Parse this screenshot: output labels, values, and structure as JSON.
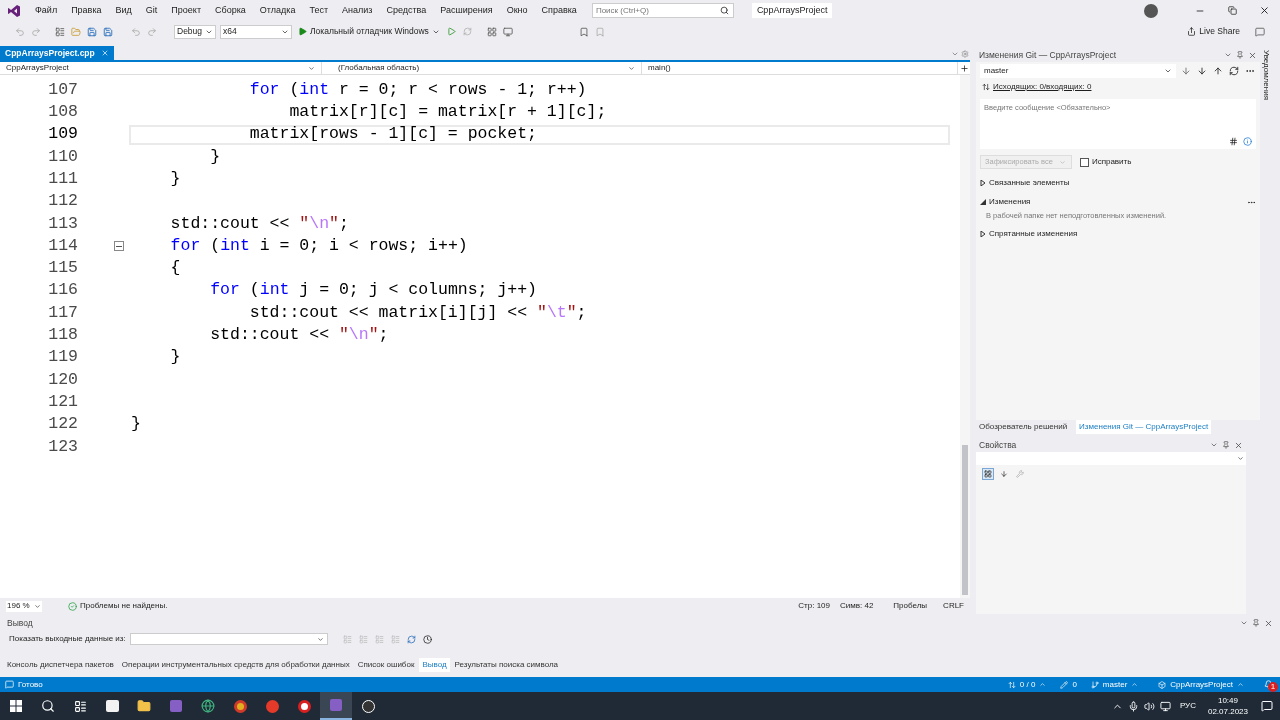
{
  "menu": [
    "Файл",
    "Правка",
    "Вид",
    "Git",
    "Проект",
    "Сборка",
    "Отладка",
    "Тест",
    "Анализ",
    "Средства",
    "Расширения",
    "Окно",
    "Справка"
  ],
  "search": {
    "placeholder": "Поиск (Ctrl+Q)"
  },
  "solution_name": "CppArraysProject",
  "toolbar": {
    "configuration": "Debug",
    "platform": "x64",
    "run": "Локальный отладчик Windows",
    "live_share": "Live Share"
  },
  "editor": {
    "tabs": [
      {
        "label": "CppArraysProject.cpp",
        "selected": true
      }
    ],
    "nav": [
      "CppArraysProject",
      "(Глобальная область)",
      "main()"
    ],
    "lines": [
      {
        "number": "107",
        "current": false,
        "kind": "code",
        "tokens": [
          {
            "text": "            for",
            "kind": "keyword"
          },
          {
            "text": " (",
            "kind": "plain"
          },
          {
            "text": "int",
            "kind": "keyword"
          },
          {
            "text": " r = 0; r < rows - 1; r++)",
            "kind": "plain"
          }
        ]
      },
      {
        "number": "108",
        "current": false,
        "kind": "code",
        "tokens": [
          {
            "text": "                matrix[r][c] = matrix[r + 1][c];",
            "kind": "plain"
          }
        ]
      },
      {
        "number": "109",
        "current": true,
        "kind": "code",
        "tokens": [
          {
            "text": "            matrix[rows - 1][c] = pocket;",
            "kind": "plain"
          }
        ]
      },
      {
        "number": "110",
        "current": false,
        "kind": "code",
        "tokens": [
          {
            "text": "        }",
            "kind": "plain"
          }
        ]
      },
      {
        "number": "111",
        "current": false,
        "kind": "code",
        "tokens": [
          {
            "text": "    }",
            "kind": "plain"
          }
        ]
      },
      {
        "number": "112",
        "current": false,
        "kind": "code"
      },
      {
        "number": "113",
        "current": false,
        "kind": "code",
        "tokens": [
          {
            "text": "    std::cout << ",
            "kind": "plain"
          },
          {
            "text": "\"",
            "kind": "string"
          },
          {
            "text": "\\n",
            "kind": "escape"
          },
          {
            "text": "\"",
            "kind": "string"
          },
          {
            "text": ";",
            "kind": "plain"
          }
        ]
      },
      {
        "number": "114",
        "current": false,
        "kind": "block-start",
        "tokens": [
          {
            "text": "    for",
            "kind": "keyword"
          },
          {
            "text": " (",
            "kind": "plain"
          },
          {
            "text": "int",
            "kind": "keyword"
          },
          {
            "text": " i = 0; i < rows; i++)",
            "kind": "plain"
          }
        ]
      },
      {
        "number": "115",
        "current": false,
        "kind": "code",
        "tokens": [
          {
            "text": "    {",
            "kind": "plain"
          }
        ]
      },
      {
        "number": "116",
        "current": false,
        "kind": "code",
        "tokens": [
          {
            "text": "        for",
            "kind": "keyword"
          },
          {
            "text": " (",
            "kind": "plain"
          },
          {
            "text": "int",
            "kind": "keyword"
          },
          {
            "text": " j = 0; j < columns; j++)",
            "kind": "plain"
          }
        ]
      },
      {
        "number": "117",
        "current": false,
        "kind": "code",
        "tokens": [
          {
            "text": "            std::cout << matrix[i][j] << ",
            "kind": "plain"
          },
          {
            "text": "\"",
            "kind": "string"
          },
          {
            "text": "\\t",
            "kind": "escape"
          },
          {
            "text": "\"",
            "kind": "string"
          },
          {
            "text": ";",
            "kind": "plain"
          }
        ]
      },
      {
        "number": "118",
        "current": false,
        "kind": "code",
        "tokens": [
          {
            "text": "        std::cout << ",
            "kind": "plain"
          },
          {
            "text": "\"",
            "kind": "string"
          },
          {
            "text": "\\n",
            "kind": "escape"
          },
          {
            "text": "\"",
            "kind": "string"
          },
          {
            "text": ";",
            "kind": "plain"
          }
        ]
      },
      {
        "number": "119",
        "current": false,
        "kind": "code",
        "tokens": [
          {
            "text": "    }",
            "kind": "plain"
          }
        ]
      },
      {
        "number": "120",
        "current": false,
        "kind": "code"
      },
      {
        "number": "121",
        "current": false,
        "kind": "code"
      },
      {
        "number": "122",
        "current": false,
        "kind": "code",
        "tokens": [
          {
            "text": "}",
            "kind": "plain"
          }
        ]
      },
      {
        "number": "123",
        "current": false,
        "kind": "code"
      }
    ],
    "zoom": "196 %",
    "issues": "Проблемы не найдены.",
    "position": "Стр: 109",
    "column": "Симв: 42",
    "whitespace": "Пробелы",
    "line_ending": "CRLF"
  },
  "git_panel": {
    "title": "Изменения Git — CppArraysProject",
    "branch": "master",
    "sync": "Исходящих: 0/входящих: 0",
    "message_placeholder": "Введите сообщение <Обязательно>",
    "commit": {
      "label": "Зафиксировать все",
      "disabled": true
    },
    "amend": {
      "label": "Исправить",
      "checked": false
    },
    "sections": [
      {
        "label": "Связанные элементы",
        "expanded": false
      },
      {
        "label": "Изменения",
        "expanded": true,
        "note": "В рабочей папке нет неподготовленных изменений."
      },
      {
        "label": "Спрятанные изменения",
        "expanded": false
      }
    ]
  },
  "panel_tabs": [
    {
      "label": "Обозреватель решений",
      "selected": false
    },
    {
      "label": "Изменения Git — CppArraysProject",
      "selected": true
    }
  ],
  "properties": {
    "title": "Свойства"
  },
  "notifications_strip": "Уведомления",
  "output": {
    "title": "Вывод",
    "source_label": "Показать выходные данные из:"
  },
  "bottom_tabs": [
    {
      "label": "Консоль диспетчера пакетов",
      "selected": false
    },
    {
      "label": "Операции инструментальных средств для обработки данных",
      "selected": false
    },
    {
      "label": "Список ошибок",
      "selected": false
    },
    {
      "label": "Вывод",
      "selected": true
    },
    {
      "label": "Результаты поиска символа",
      "selected": false
    }
  ],
  "status_bar": {
    "ready": "Готово",
    "sync": "0 / 0",
    "edits": "0",
    "branch": "master",
    "project": "CppArraysProject",
    "notifications": "1"
  },
  "taskbar": {
    "language": "РУС",
    "time": "10:49",
    "date": "02.07.2023"
  }
}
